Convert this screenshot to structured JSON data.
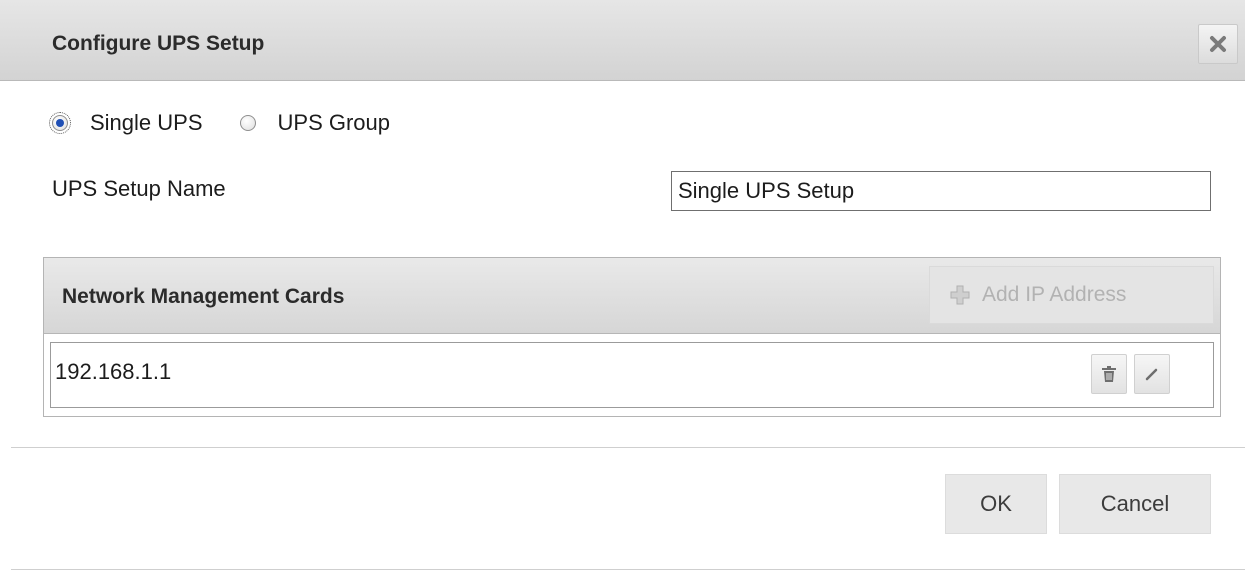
{
  "dialog": {
    "title": "Configure UPS Setup",
    "close_icon": "close-icon"
  },
  "setup_type": {
    "options": [
      {
        "label": "Single UPS",
        "checked": true
      },
      {
        "label": "UPS Group",
        "checked": false
      }
    ]
  },
  "setup_name": {
    "label": "UPS Setup Name",
    "value": "Single UPS Setup"
  },
  "nmc_panel": {
    "title": "Network Management Cards",
    "add_button_label": "Add IP Address",
    "add_icon": "plus-icon",
    "rows": [
      {
        "ip": "192.168.1.1",
        "delete_icon": "trash-icon",
        "edit_icon": "pencil-icon"
      }
    ]
  },
  "footer": {
    "ok_label": "OK",
    "cancel_label": "Cancel"
  },
  "colors": {
    "header_bg": "#d9d9d9",
    "radio_selected": "#1f4fb5",
    "disabled_text": "#b2b2b2"
  }
}
